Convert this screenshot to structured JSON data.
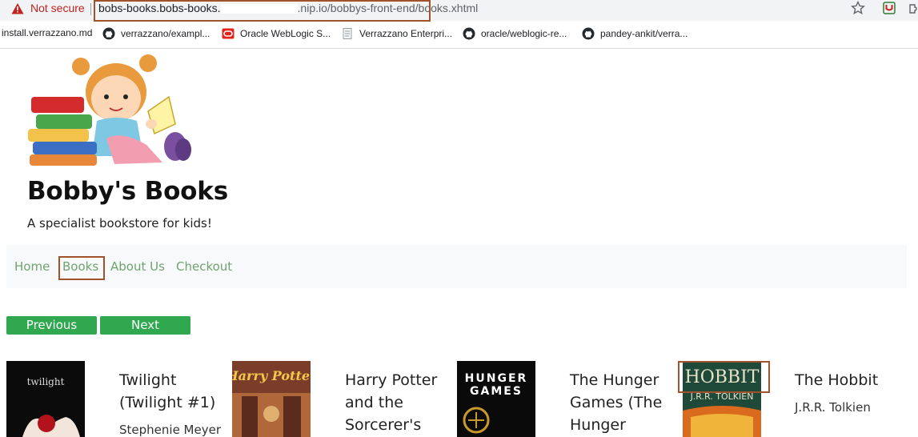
{
  "browser": {
    "security_label": "Not secure",
    "url_host": "bobs-books.bobs-books.",
    "url_host_tail": ".nip.io",
    "url_path": "/bobbys-front-end/",
    "url_page": "books.xhtml",
    "bookmarks": [
      {
        "label": "install.verrazzano.md",
        "icon": "none"
      },
      {
        "label": "verrazzano/exampl...",
        "icon": "github-icon"
      },
      {
        "label": "Oracle WebLogic S...",
        "icon": "oracle-icon"
      },
      {
        "label": "Verrazzano Enterpri...",
        "icon": "document-icon"
      },
      {
        "label": "oracle/weblogic-re...",
        "icon": "github-icon"
      },
      {
        "label": "pandey-ankit/verra...",
        "icon": "github-icon"
      }
    ]
  },
  "site": {
    "title": "Bobby's Books",
    "tagline": "A specialist bookstore for kids!"
  },
  "nav": {
    "items": [
      {
        "label": "Home"
      },
      {
        "label": "Books"
      },
      {
        "label": "About Us"
      },
      {
        "label": "Checkout"
      }
    ]
  },
  "pager": {
    "previous_label": "Previous",
    "next_label": "Next"
  },
  "books": [
    {
      "title_lines": [
        "Twilight",
        "(Twilight #1)"
      ],
      "author": "Stephenie Meyer",
      "cover_text": "twilight"
    },
    {
      "title_lines": [
        "Harry Potter",
        "and the",
        "Sorcerer's"
      ],
      "author": "",
      "cover_text": "Harry Potter"
    },
    {
      "title_lines": [
        "The Hunger",
        "Games (The",
        "Hunger Games"
      ],
      "author": "",
      "cover_text": "THE HUNGER GAMES"
    },
    {
      "title_lines": [
        "The Hobbit"
      ],
      "author": "J.R.R. Tolkien",
      "cover_text": "HOBBIT",
      "cover_subtext": "J.R.R. TOLKIEN"
    }
  ],
  "colors": {
    "nav_link": "#6fa36f",
    "button": "#2fa84f",
    "highlight_box": "#a0522d",
    "not_secure": "#c5221f"
  }
}
